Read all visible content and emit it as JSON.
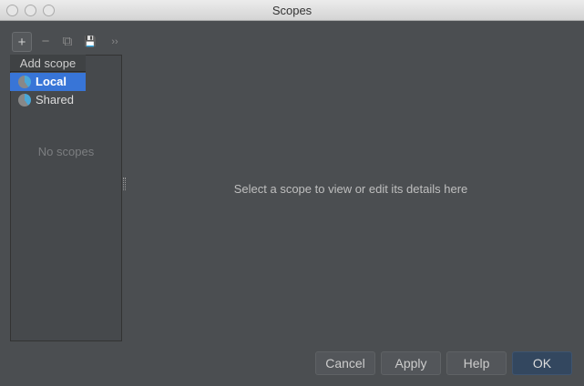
{
  "window": {
    "title": "Scopes"
  },
  "toolbar": {
    "add": "+",
    "remove": "−",
    "copy": "⧉",
    "save": "💾",
    "more": "››",
    "tooltip": "Add scope"
  },
  "menu": [
    {
      "label": "Local"
    },
    {
      "label": "Shared"
    }
  ],
  "list": {
    "empty": "No scopes"
  },
  "details": {
    "message": "Select a scope to view or edit its details here"
  },
  "buttons": {
    "cancel": "Cancel",
    "apply": "Apply",
    "help": "Help",
    "ok": "OK"
  },
  "colors": {
    "selection": "#3875d7",
    "ok": "#33475f"
  }
}
